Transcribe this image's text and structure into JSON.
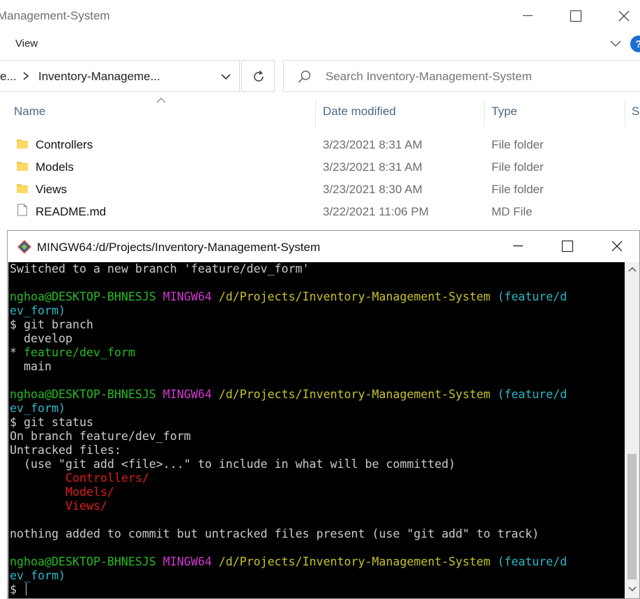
{
  "explorer": {
    "title": "Management-System",
    "ribbon_view": "View",
    "help_glyph": "?",
    "address": {
      "prev_segment": "e...",
      "current": "Inventory-Manageme..."
    },
    "search": {
      "placeholder": "Search Inventory-Management-System"
    },
    "columns": {
      "name": "Name",
      "date": "Date modified",
      "type": "Type",
      "size": "S"
    },
    "files": [
      {
        "name": "Controllers",
        "date": "3/23/2021 8:31 AM",
        "type": "File folder",
        "icon": "folder-icon"
      },
      {
        "name": "Models",
        "date": "3/23/2021 8:31 AM",
        "type": "File folder",
        "icon": "folder-icon"
      },
      {
        "name": "Views",
        "date": "3/23/2021 8:30 AM",
        "type": "File folder",
        "icon": "folder-icon"
      },
      {
        "name": "README.md",
        "date": "3/22/2021 11:06 PM",
        "type": "MD File",
        "icon": "file-icon"
      }
    ]
  },
  "terminal": {
    "title": "MINGW64:/d/Projects/Inventory-Management-System",
    "colors": {
      "background": "#000000",
      "user": "#25bc24",
      "mingw": "#d338d3",
      "path": "#c7c329",
      "branch": "#2bb8c7",
      "untracked": "#e21b1b"
    },
    "lines": {
      "l0": "Switched to a new branch 'feature/dev_form'",
      "p1_user": "nghoa@DESKTOP-BHNESJS",
      "p1_env": "MINGW64",
      "p1_path": "/d/Projects/Inventory-Management-System",
      "p1_branch_a": "(feature/d",
      "p1_branch_b": "ev_form)",
      "cmd1": "$ git branch",
      "br1": "  develop",
      "br2_star": "* ",
      "br2": "feature/dev_form",
      "br3": "  main",
      "p2_user": "nghoa@DESKTOP-BHNESJS",
      "p2_env": "MINGW64",
      "p2_path": "/d/Projects/Inventory-Management-System",
      "p2_branch_a": "(feature/d",
      "p2_branch_b": "ev_form)",
      "cmd2": "$ git status",
      "st1": "On branch feature/dev_form",
      "st2": "Untracked files:",
      "st3": "  (use \"git add <file>...\" to include in what will be committed)",
      "ut1": "        Controllers/",
      "ut2": "        Models/",
      "ut3": "        Views/",
      "st4": "nothing added to commit but untracked files present (use \"git add\" to track)",
      "p3_user": "nghoa@DESKTOP-BHNESJS",
      "p3_env": "MINGW64",
      "p3_path": "/d/Projects/Inventory-Management-System",
      "p3_branch_a": "(feature/d",
      "p3_branch_b": "ev_form)",
      "prompt": "$"
    }
  }
}
